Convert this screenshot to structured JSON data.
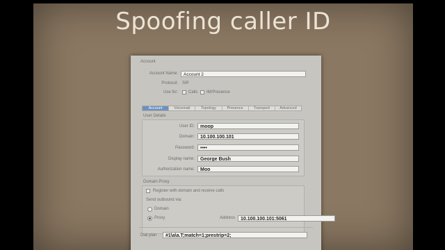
{
  "slide": {
    "title": "Spoofing caller ID"
  },
  "dialog": {
    "header": "Account",
    "account_name_label": "Account Name:",
    "account_name_value": "Account 2",
    "protocol_label": "Protocol:",
    "protocol_value": "SIP",
    "use_for_label": "Use for:",
    "use_for_calls": "Calls",
    "use_for_messages": "IM/Presence",
    "tabs": [
      "Account",
      "Voicemail",
      "Topology",
      "Presence",
      "Transport",
      "Advanced"
    ],
    "active_tab": 0,
    "user_details_header": "User Details",
    "user_details": [
      {
        "label": "User ID:",
        "value": "moop"
      },
      {
        "label": "Domain:",
        "value": "10.100.100.101"
      },
      {
        "label": "Password:",
        "value": "••••"
      },
      {
        "label": "Display name:",
        "value": "George Bush"
      },
      {
        "label": "Authorization name:",
        "value": "Moo"
      }
    ],
    "domain_proxy_header": "Domain Proxy",
    "register_label": "Register with domain and receive calls",
    "send_outbound_label": "Send outbound via:",
    "option_domain": "Domain",
    "option_proxy": "Proxy",
    "address_label": "Address",
    "proxy_address_value": "10.100.100.101:5061",
    "dial_plan_label": "Dial plan",
    "dial_plan_value": "#1\\a\\a.T;match=1;prestrip=2;"
  }
}
